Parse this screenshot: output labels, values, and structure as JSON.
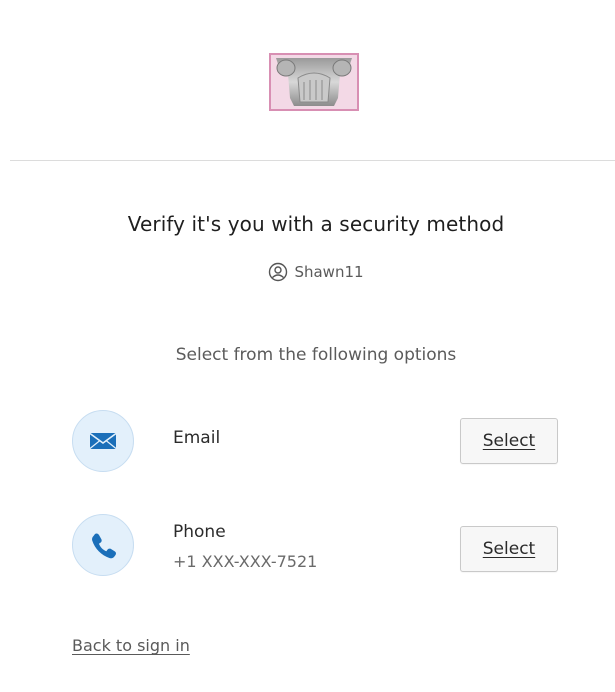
{
  "header": {
    "logo_icon": "column-capital-logo"
  },
  "main": {
    "title": "Verify it's you with a security method",
    "username": "Shawn11",
    "user_icon": "user-circle-icon",
    "subtitle": "Select from the following options"
  },
  "options": [
    {
      "icon": "mail-icon",
      "label": "Email",
      "detail": "",
      "button_label": "Select"
    },
    {
      "icon": "phone-icon",
      "label": "Phone",
      "detail": "+1 XXX-XXX-7521",
      "button_label": "Select"
    }
  ],
  "footer": {
    "back_link": "Back to sign in"
  },
  "colors": {
    "icon_bg": "#e3f0fb",
    "icon_blue": "#1b6fb9",
    "divider": "#dcdcdc"
  }
}
